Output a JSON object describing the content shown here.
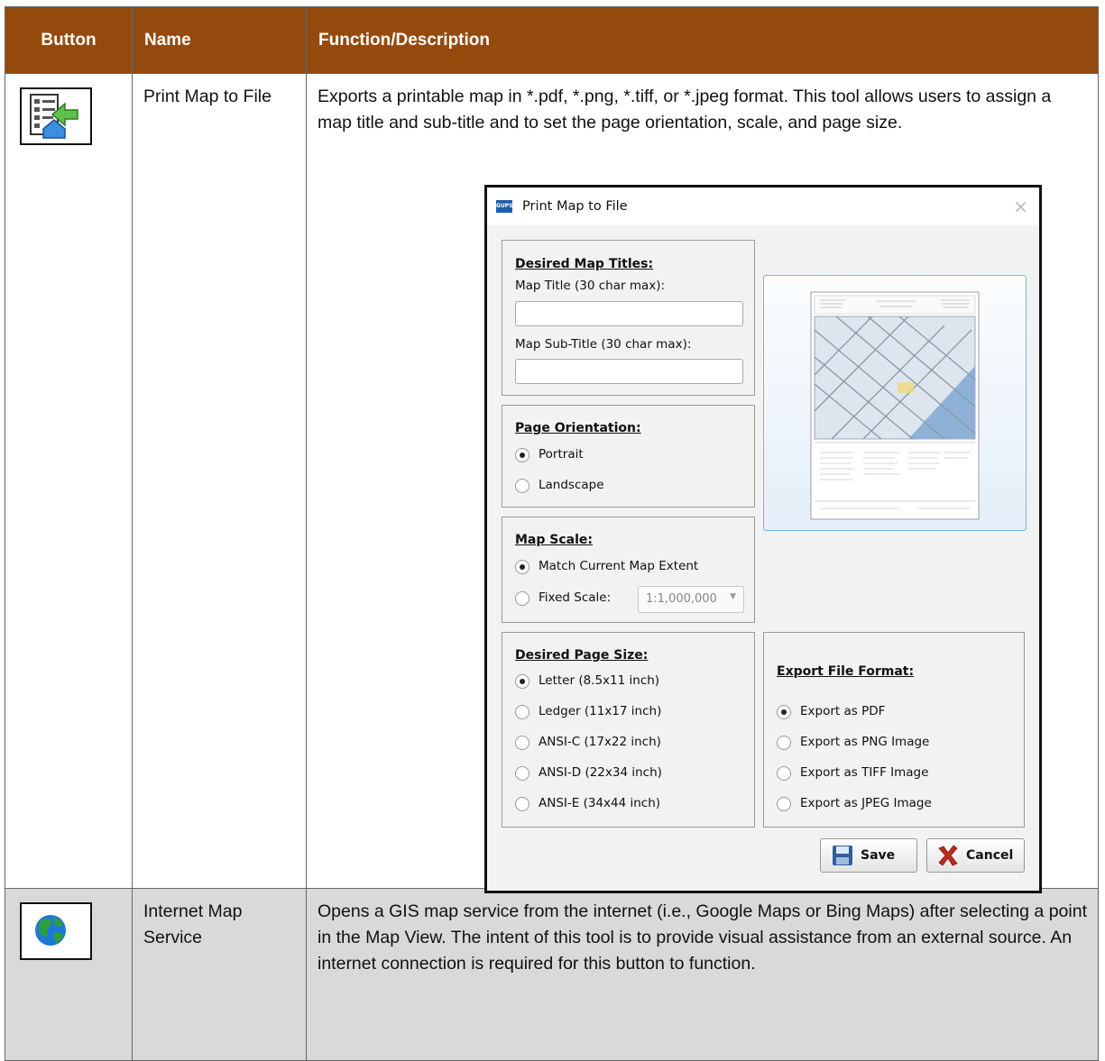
{
  "table": {
    "headers": [
      "Button",
      "Name",
      "Function/Description"
    ],
    "rows": [
      {
        "icon": "print-map-to-file-icon",
        "name": "Print Map to File",
        "description": "Exports a printable map in *.pdf, *.png, *.tiff, or *.jpeg format. This tool allows users to assign a map title and sub-title and to set the page orientation, scale, and page size."
      },
      {
        "icon": "globe-icon",
        "name": "Internet Map Service",
        "description": "Opens a GIS map service from the internet (i.e., Google Maps or Bing Maps) after selecting a point in the Map View. The intent of this tool is to provide visual assistance from an external source. An internet connection is required for this button to function."
      }
    ]
  },
  "dialog": {
    "app_icon_text": "GUPS",
    "title": "Print Map to File",
    "close_glyph": "×",
    "titles_group": {
      "heading": "Desired Map Titles:",
      "map_title_label": "Map Title (30 char max):",
      "map_title_value": "",
      "sub_title_label": "Map Sub-Title (30 char max):",
      "sub_title_value": ""
    },
    "orientation_group": {
      "heading": "Page Orientation:",
      "options": [
        "Portrait",
        "Landscape"
      ],
      "selected": "Portrait"
    },
    "scale_group": {
      "heading": "Map Scale:",
      "options": [
        "Match Current Map Extent",
        "Fixed Scale:"
      ],
      "selected": "Match Current Map Extent",
      "fixed_scale_value": "1:1,000,000"
    },
    "page_size_group": {
      "heading": "Desired Page Size:",
      "options": [
        "Letter (8.5x11 inch)",
        "Ledger (11x17 inch)",
        "ANSI-C (17x22 inch)",
        "ANSI-D (22x34 inch)",
        "ANSI-E (34x44 inch)"
      ],
      "selected": "Letter (8.5x11 inch)"
    },
    "format_group": {
      "heading": "Export File Format:",
      "options": [
        "Export as PDF",
        "Export as PNG Image",
        "Export as TIFF Image",
        "Export as JPEG Image"
      ],
      "selected": "Export as PDF"
    },
    "buttons": {
      "save": "Save",
      "cancel": "Cancel"
    }
  }
}
